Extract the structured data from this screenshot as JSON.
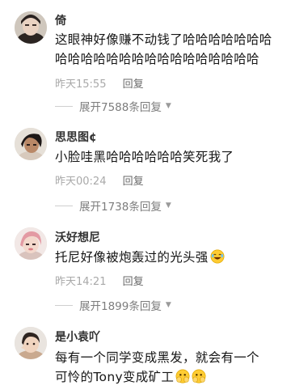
{
  "comments": [
    {
      "name": "倚",
      "text": "这眼神好像赚不动钱了哈哈哈哈哈哈哈哈哈哈哈哈哈哈哈哈哈哈哈哈哈哈哈",
      "time": "昨天15:55",
      "reply_label": "回复",
      "expand_label": "展开7588条回复",
      "avatar_icon": "user-avatar-icon"
    },
    {
      "name": "思思图¢",
      "text": "小脸哇黑哈哈哈哈哈哈笑死我了",
      "time": "昨天00:24",
      "reply_label": "回复",
      "expand_label": "展开1738条回复",
      "avatar_icon": "user-avatar-icon"
    },
    {
      "name": "沃好想尼",
      "text": "托尼好像被炮轰过的光头强",
      "time": "昨天14:21",
      "reply_label": "回复",
      "expand_label": "展开1899条回复",
      "avatar_icon": "user-avatar-icon",
      "emoji": "laughing-face-emoji"
    },
    {
      "name": "是小袁吖",
      "text_line1": "每有一个同学变成黑发，就会有一个",
      "text_line2": "可怜的Tony变成矿工",
      "avatar_icon": "user-avatar-icon",
      "emoji": "peeking-face-emoji"
    }
  ]
}
